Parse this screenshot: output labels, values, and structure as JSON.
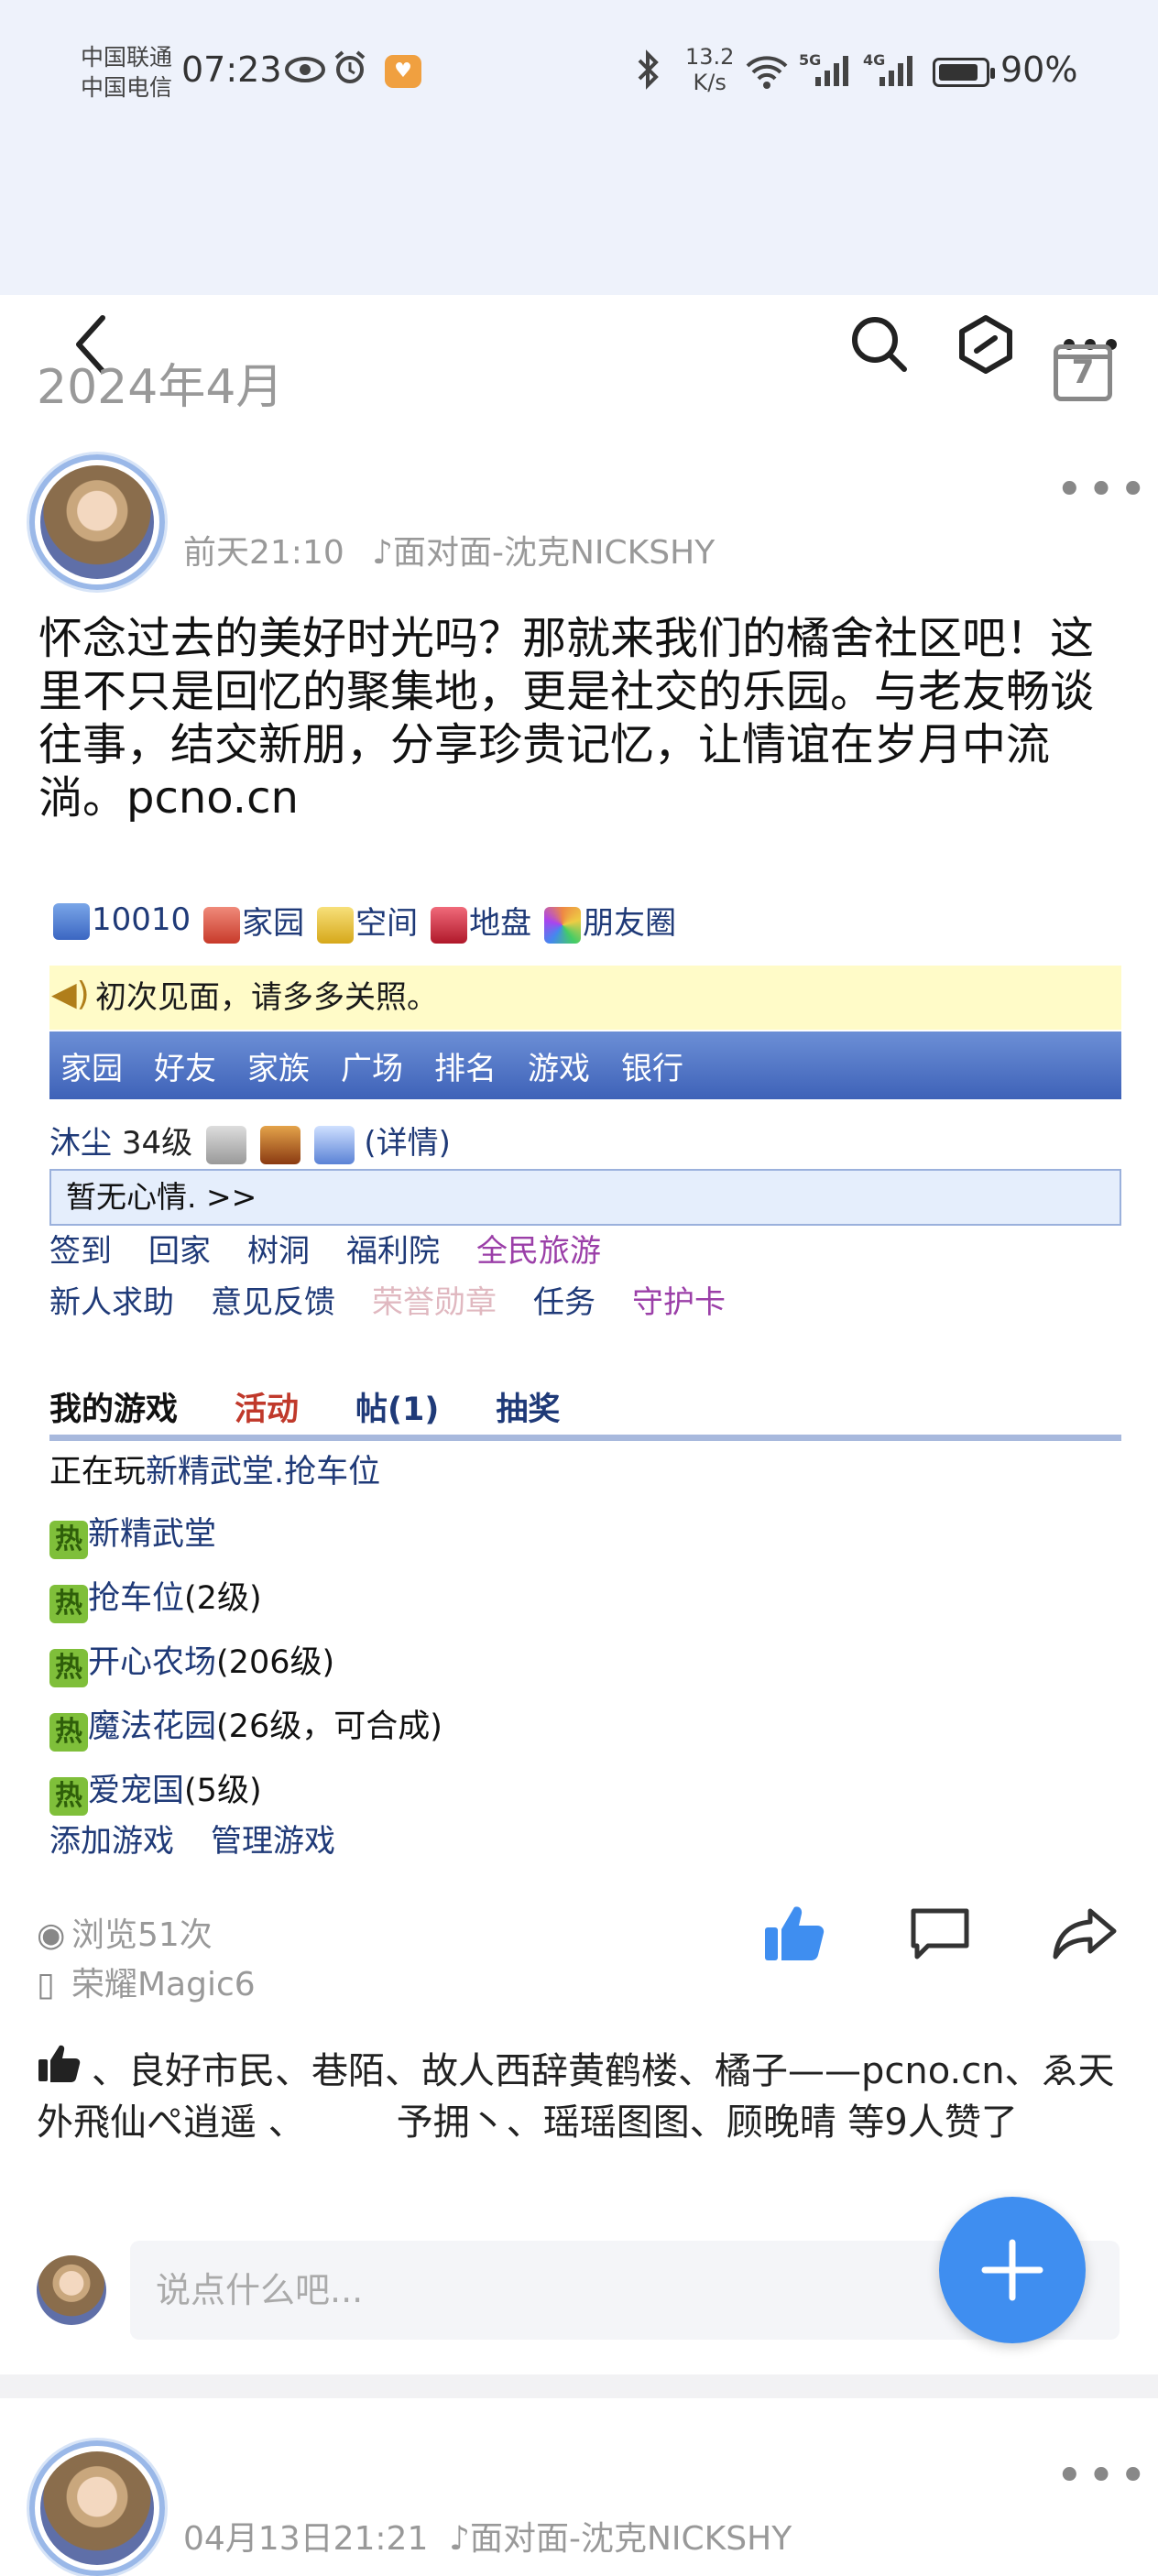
{
  "status_bar": {
    "carrier_1": "中国联通",
    "carrier_2": "中国电信",
    "time": "07:23",
    "speed_value": "13.2",
    "speed_unit": "K/s",
    "network_1": "5G",
    "network_2": "4G",
    "battery": "90%",
    "battery_level": 0.9
  },
  "post_1": {
    "month_header": "2024年4月",
    "calendar_day": "7",
    "time": "前天21:10",
    "source": "面对面-沈克NICKSHY",
    "text": "怀念过去的美好时光吗？那就来我们的橘舍社区吧！这里不只是回忆的聚集地，更是社交的乐园。与老友畅谈往事，结交新朋，分享珍贵记忆，让情谊在岁月中流淌。pcno.cn",
    "embed": {
      "top_links": [
        "10010",
        "家园",
        "空间",
        "地盘",
        "朋友圈"
      ],
      "notice": "初次见面，请多多关照。",
      "bar_links": [
        "家园",
        "好友",
        "家族",
        "广场",
        "排名",
        "游戏",
        "银行"
      ],
      "user_name": "沐尘",
      "user_level": "34级",
      "details": "(详情)",
      "mood": "暂无心情. >>",
      "row_a": [
        "签到",
        "回家",
        "树洞",
        "福利院",
        "全民旅游"
      ],
      "row_b": [
        "新人求助",
        "意见反馈",
        "荣誉勋章",
        "任务",
        "守护卡"
      ],
      "tabs": [
        "我的游戏",
        "活动",
        "帖(1)",
        "抽奖"
      ],
      "playing_prefix": "正在玩",
      "playing_games": "新精武堂.抢车位",
      "hot_badge": "热",
      "games": [
        {
          "name": "新精武堂",
          "suffix": ""
        },
        {
          "name": "抢车位",
          "suffix": "(2级)"
        },
        {
          "name": "开心农场",
          "suffix": "(206级)"
        },
        {
          "name": "魔法花园",
          "suffix": "(26级，可合成)"
        },
        {
          "name": "爱宠国",
          "suffix": "(5级)"
        }
      ],
      "manage": [
        "添加游戏",
        "管理游戏"
      ]
    },
    "views": "浏览51次",
    "device": "荣耀Magic6",
    "likes_text": "、良好市民、巷陌、故人西辞黄鹤楼、橘子——pcno.cn、ゑ天外飛仙ぺ逍遥 、　　　予拥丶、瑶瑶图图、顾晚晴 等9人赞了",
    "comment_placeholder": "说点什么吧..."
  },
  "post_2": {
    "time": "04月13日21:21",
    "source": "面对面-沈克NICKSHY"
  },
  "colors": {
    "accent": "#3f8ef0",
    "link": "#1f3a78",
    "activity_tab": "#c0392b",
    "tab_blue": "#1f3a78",
    "muted_link": "#e0b8c0",
    "purple_link": "#9b3fa8"
  }
}
